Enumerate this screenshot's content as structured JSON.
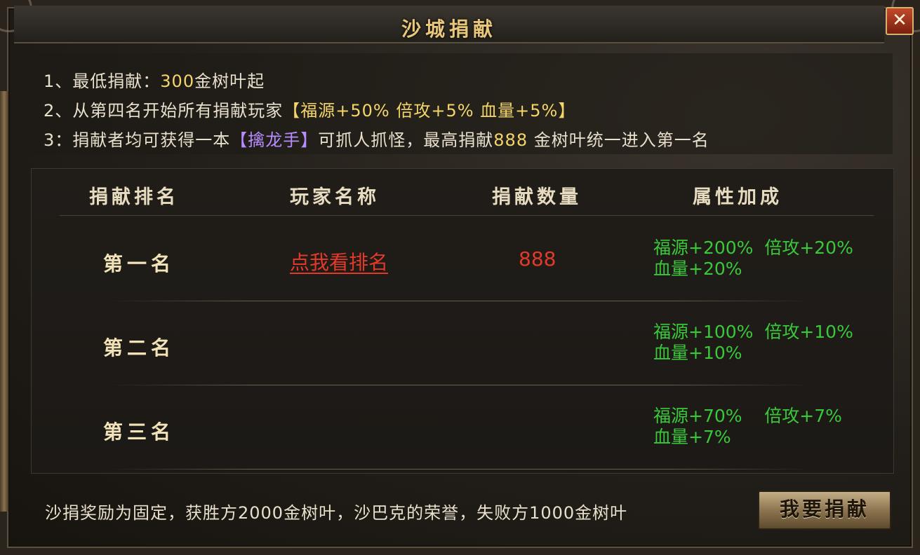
{
  "window": {
    "title": "沙城捐献",
    "close_label": "✕"
  },
  "rules": [
    {
      "prefix": "1、最低捐献：",
      "highlight": "300",
      "suffix": "金树叶起"
    },
    {
      "prefix": "2、从第四名开始所有捐献玩家",
      "highlight": "【福源+50% 倍攻+5% 血量+5%】",
      "suffix": ""
    },
    {
      "prefix": "3：捐献者均可获得一本",
      "highlight": "【擒龙手】",
      "mid": "可抓人抓怪，最高捐献",
      "highlight2": "888",
      "suffix": " 金树叶统一进入第一名"
    }
  ],
  "table": {
    "headers": [
      "捐献排名",
      "玩家名称",
      "捐献数量",
      "属性加成"
    ],
    "rows": [
      {
        "rank": "第一名",
        "player": "点我看排名",
        "amount": "888",
        "bonus_line1": "福源+200%  倍攻+20%",
        "bonus_line2": "血量+20%"
      },
      {
        "rank": "第二名",
        "player": "",
        "amount": "",
        "bonus_line1": "福源+100%  倍攻+10%",
        "bonus_line2": "血量+10%"
      },
      {
        "rank": "第三名",
        "player": "",
        "amount": "",
        "bonus_line1": "福源+70%    倍攻+7%",
        "bonus_line2": "血量+7%"
      }
    ]
  },
  "footer": {
    "text": "沙捐奖励为固定，获胜方2000金树叶，沙巴克的荣誉，失败方1000金树叶",
    "donate_button": "我要捐献"
  },
  "colors": {
    "title": "#e9c77a",
    "gold_text": "#f4d56a",
    "purple_text": "#b78cff",
    "red_text": "#e23a2a",
    "green_text": "#3ac83a"
  }
}
